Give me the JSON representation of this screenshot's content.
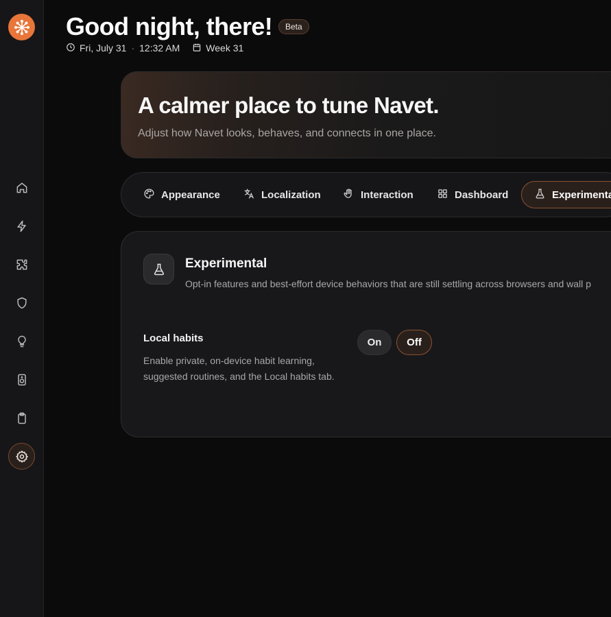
{
  "header": {
    "greeting": "Good night, there!",
    "badge": "Beta",
    "date": "Fri, July 31",
    "separator": "·",
    "time": "12:32 AM",
    "week": "Week 31"
  },
  "sidebar": {
    "logo_icon": "sparkle-logo-icon",
    "items": [
      {
        "icon": "home-icon",
        "active": false
      },
      {
        "icon": "lightning-icon",
        "active": false
      },
      {
        "icon": "puzzle-icon",
        "active": false
      },
      {
        "icon": "shield-icon",
        "active": false
      },
      {
        "icon": "lightbulb-icon",
        "active": false
      },
      {
        "icon": "speaker-icon",
        "active": false
      },
      {
        "icon": "clipboard-icon",
        "active": false
      },
      {
        "icon": "gear-icon",
        "active": true
      }
    ]
  },
  "hero": {
    "title": "A calmer place to tune Navet.",
    "subtitle": "Adjust how Navet looks, behaves, and connects in one place."
  },
  "tabs": [
    {
      "label": "Appearance",
      "icon": "palette-icon",
      "active": false
    },
    {
      "label": "Localization",
      "icon": "translate-icon",
      "active": false
    },
    {
      "label": "Interaction",
      "icon": "hand-icon",
      "active": false
    },
    {
      "label": "Dashboard",
      "icon": "grid-icon",
      "active": false
    },
    {
      "label": "Experimental",
      "icon": "flask-icon",
      "active": true
    }
  ],
  "section": {
    "icon": "flask-icon",
    "title": "Experimental",
    "description": "Opt-in features and best-effort device behaviors that are still settling across browsers and wall p",
    "setting": {
      "label": "Local habits",
      "description": "Enable private, on-device habit learning, suggested routines, and the Local habits tab.",
      "options": [
        "On",
        "Off"
      ],
      "selected": "Off"
    }
  },
  "colors": {
    "accent": "#e8763a",
    "background": "#0b0b0c",
    "active_border": "#8a5233"
  }
}
